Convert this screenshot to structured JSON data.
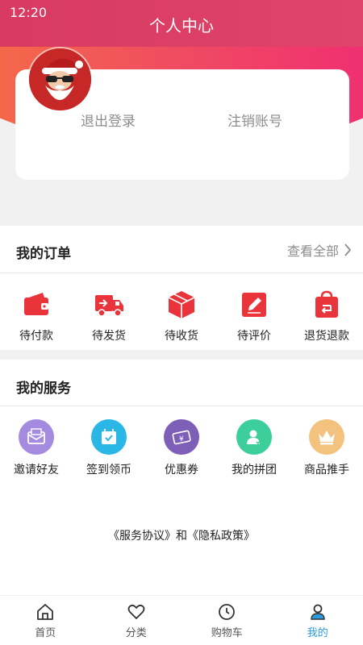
{
  "status_bar": {
    "time": "12:20"
  },
  "header": {
    "title": "个人中心"
  },
  "profile_card": {
    "logout_label": "退出登录",
    "deregister_label": "注销账号"
  },
  "orders": {
    "title": "我的订单",
    "view_all": "查看全部",
    "items": [
      {
        "label": "待付款",
        "icon": "wallet-icon"
      },
      {
        "label": "待发货",
        "icon": "truck-icon"
      },
      {
        "label": "待收货",
        "icon": "package-icon"
      },
      {
        "label": "待评价",
        "icon": "edit-icon"
      },
      {
        "label": "退货退款",
        "icon": "return-bag-icon"
      }
    ],
    "accent": "#e8343a"
  },
  "services": {
    "title": "我的服务",
    "items": [
      {
        "label": "邀请好友",
        "icon": "mail-icon",
        "color": "#a58be0"
      },
      {
        "label": "签到领币",
        "icon": "calendar-check-icon",
        "color": "#2ab7e6"
      },
      {
        "label": "优惠券",
        "icon": "coupon-icon",
        "color": "#7e5fb8"
      },
      {
        "label": "我的拼团",
        "icon": "group-user-icon",
        "color": "#3ccf9c"
      },
      {
        "label": "商品推手",
        "icon": "crown-icon",
        "color": "#f2c27e"
      }
    ]
  },
  "policy_text": "《服务协议》和《隐私政策》",
  "tabbar": {
    "items": [
      {
        "label": "首页",
        "icon": "home-icon"
      },
      {
        "label": "分类",
        "icon": "heart-icon"
      },
      {
        "label": "购物车",
        "icon": "clock-icon"
      },
      {
        "label": "我的",
        "icon": "user-icon"
      }
    ],
    "active_index": 3,
    "active_color": "#2a9be0"
  }
}
